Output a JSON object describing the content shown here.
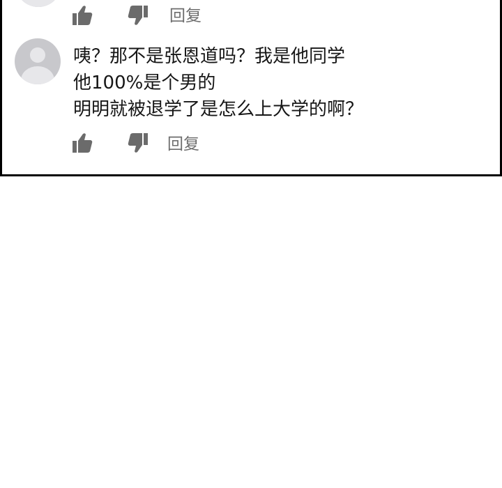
{
  "comments": [
    {
      "actions": {
        "like_icon": "thumbs-up-icon",
        "dislike_icon": "thumbs-down-icon",
        "reply_label": "回复"
      }
    },
    {
      "avatar_icon": "default-user-avatar",
      "lines": [
        "咦？那不是张恩道吗？我是他同学",
        "他100%是个男的",
        "明明就被退学了是怎么上大学的啊？"
      ],
      "actions": {
        "like_icon": "thumbs-up-icon",
        "dislike_icon": "thumbs-down-icon",
        "reply_label": "回复"
      }
    }
  ],
  "colors": {
    "icon": "#6b6b6b",
    "avatar_bg": "#c8c8cc",
    "border": "#000000"
  }
}
